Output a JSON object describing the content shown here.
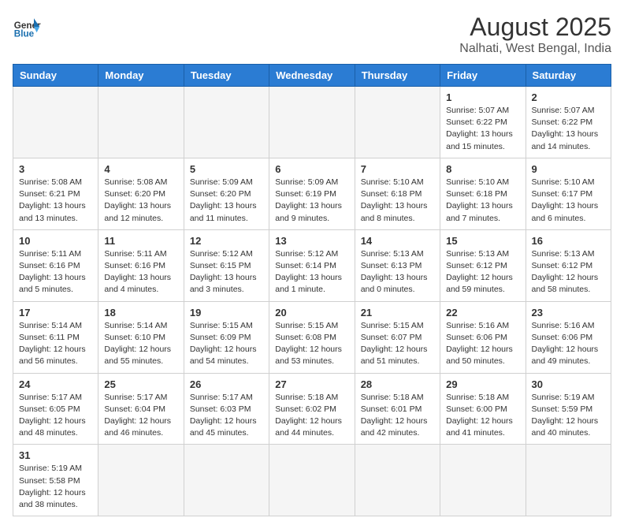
{
  "header": {
    "logo_general": "General",
    "logo_blue": "Blue",
    "main_title": "August 2025",
    "subtitle": "Nalhati, West Bengal, India"
  },
  "weekdays": [
    "Sunday",
    "Monday",
    "Tuesday",
    "Wednesday",
    "Thursday",
    "Friday",
    "Saturday"
  ],
  "weeks": [
    [
      {
        "day": "",
        "info": ""
      },
      {
        "day": "",
        "info": ""
      },
      {
        "day": "",
        "info": ""
      },
      {
        "day": "",
        "info": ""
      },
      {
        "day": "",
        "info": ""
      },
      {
        "day": "1",
        "info": "Sunrise: 5:07 AM\nSunset: 6:22 PM\nDaylight: 13 hours\nand 15 minutes."
      },
      {
        "day": "2",
        "info": "Sunrise: 5:07 AM\nSunset: 6:22 PM\nDaylight: 13 hours\nand 14 minutes."
      }
    ],
    [
      {
        "day": "3",
        "info": "Sunrise: 5:08 AM\nSunset: 6:21 PM\nDaylight: 13 hours\nand 13 minutes."
      },
      {
        "day": "4",
        "info": "Sunrise: 5:08 AM\nSunset: 6:20 PM\nDaylight: 13 hours\nand 12 minutes."
      },
      {
        "day": "5",
        "info": "Sunrise: 5:09 AM\nSunset: 6:20 PM\nDaylight: 13 hours\nand 11 minutes."
      },
      {
        "day": "6",
        "info": "Sunrise: 5:09 AM\nSunset: 6:19 PM\nDaylight: 13 hours\nand 9 minutes."
      },
      {
        "day": "7",
        "info": "Sunrise: 5:10 AM\nSunset: 6:18 PM\nDaylight: 13 hours\nand 8 minutes."
      },
      {
        "day": "8",
        "info": "Sunrise: 5:10 AM\nSunset: 6:18 PM\nDaylight: 13 hours\nand 7 minutes."
      },
      {
        "day": "9",
        "info": "Sunrise: 5:10 AM\nSunset: 6:17 PM\nDaylight: 13 hours\nand 6 minutes."
      }
    ],
    [
      {
        "day": "10",
        "info": "Sunrise: 5:11 AM\nSunset: 6:16 PM\nDaylight: 13 hours\nand 5 minutes."
      },
      {
        "day": "11",
        "info": "Sunrise: 5:11 AM\nSunset: 6:16 PM\nDaylight: 13 hours\nand 4 minutes."
      },
      {
        "day": "12",
        "info": "Sunrise: 5:12 AM\nSunset: 6:15 PM\nDaylight: 13 hours\nand 3 minutes."
      },
      {
        "day": "13",
        "info": "Sunrise: 5:12 AM\nSunset: 6:14 PM\nDaylight: 13 hours\nand 1 minute."
      },
      {
        "day": "14",
        "info": "Sunrise: 5:13 AM\nSunset: 6:13 PM\nDaylight: 13 hours\nand 0 minutes."
      },
      {
        "day": "15",
        "info": "Sunrise: 5:13 AM\nSunset: 6:12 PM\nDaylight: 12 hours\nand 59 minutes."
      },
      {
        "day": "16",
        "info": "Sunrise: 5:13 AM\nSunset: 6:12 PM\nDaylight: 12 hours\nand 58 minutes."
      }
    ],
    [
      {
        "day": "17",
        "info": "Sunrise: 5:14 AM\nSunset: 6:11 PM\nDaylight: 12 hours\nand 56 minutes."
      },
      {
        "day": "18",
        "info": "Sunrise: 5:14 AM\nSunset: 6:10 PM\nDaylight: 12 hours\nand 55 minutes."
      },
      {
        "day": "19",
        "info": "Sunrise: 5:15 AM\nSunset: 6:09 PM\nDaylight: 12 hours\nand 54 minutes."
      },
      {
        "day": "20",
        "info": "Sunrise: 5:15 AM\nSunset: 6:08 PM\nDaylight: 12 hours\nand 53 minutes."
      },
      {
        "day": "21",
        "info": "Sunrise: 5:15 AM\nSunset: 6:07 PM\nDaylight: 12 hours\nand 51 minutes."
      },
      {
        "day": "22",
        "info": "Sunrise: 5:16 AM\nSunset: 6:06 PM\nDaylight: 12 hours\nand 50 minutes."
      },
      {
        "day": "23",
        "info": "Sunrise: 5:16 AM\nSunset: 6:06 PM\nDaylight: 12 hours\nand 49 minutes."
      }
    ],
    [
      {
        "day": "24",
        "info": "Sunrise: 5:17 AM\nSunset: 6:05 PM\nDaylight: 12 hours\nand 48 minutes."
      },
      {
        "day": "25",
        "info": "Sunrise: 5:17 AM\nSunset: 6:04 PM\nDaylight: 12 hours\nand 46 minutes."
      },
      {
        "day": "26",
        "info": "Sunrise: 5:17 AM\nSunset: 6:03 PM\nDaylight: 12 hours\nand 45 minutes."
      },
      {
        "day": "27",
        "info": "Sunrise: 5:18 AM\nSunset: 6:02 PM\nDaylight: 12 hours\nand 44 minutes."
      },
      {
        "day": "28",
        "info": "Sunrise: 5:18 AM\nSunset: 6:01 PM\nDaylight: 12 hours\nand 42 minutes."
      },
      {
        "day": "29",
        "info": "Sunrise: 5:18 AM\nSunset: 6:00 PM\nDaylight: 12 hours\nand 41 minutes."
      },
      {
        "day": "30",
        "info": "Sunrise: 5:19 AM\nSunset: 5:59 PM\nDaylight: 12 hours\nand 40 minutes."
      }
    ],
    [
      {
        "day": "31",
        "info": "Sunrise: 5:19 AM\nSunset: 5:58 PM\nDaylight: 12 hours\nand 38 minutes."
      },
      {
        "day": "",
        "info": ""
      },
      {
        "day": "",
        "info": ""
      },
      {
        "day": "",
        "info": ""
      },
      {
        "day": "",
        "info": ""
      },
      {
        "day": "",
        "info": ""
      },
      {
        "day": "",
        "info": ""
      }
    ]
  ]
}
